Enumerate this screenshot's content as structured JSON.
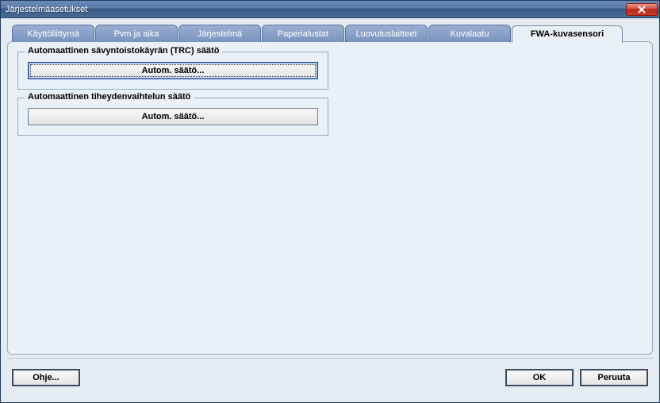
{
  "window": {
    "title": "Järjestelmäasetukset"
  },
  "tabs": [
    {
      "label": "Käyttöliittymä",
      "active": false
    },
    {
      "label": "Pvm ja aika",
      "active": false
    },
    {
      "label": "Järjestelmä",
      "active": false
    },
    {
      "label": "Paperialustat",
      "active": false
    },
    {
      "label": "Luovutuslaitteet",
      "active": false
    },
    {
      "label": "Kuvalaatu",
      "active": false
    },
    {
      "label": "FWA-kuvasensori",
      "active": true
    }
  ],
  "groups": {
    "trc": {
      "title": "Automaattinen sävyntoistokäyrän (TRC) säätö",
      "button": "Autom. säätö..."
    },
    "density": {
      "title": "Automaattinen tiheydenvaihtelun säätö",
      "button": "Autom. säätö..."
    }
  },
  "buttons": {
    "help": "Ohje...",
    "ok": "OK",
    "cancel": "Peruuta"
  }
}
